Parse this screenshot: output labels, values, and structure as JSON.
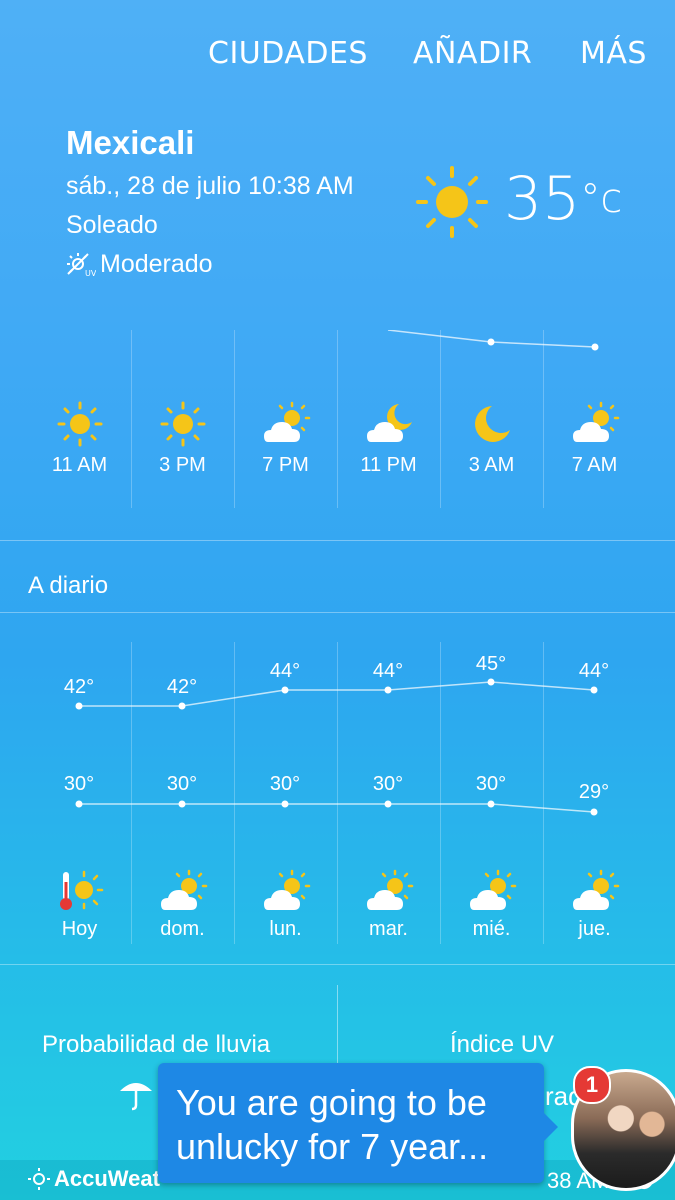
{
  "nav": {
    "items": [
      "CIUDADES",
      "AÑADIR",
      "MÁS"
    ]
  },
  "current": {
    "city": "Mexicali",
    "date": "sáb., 28 de julio 10:38 AM",
    "condition": "Soleado",
    "uv": "Moderado",
    "temperature": "35",
    "unit": "°c"
  },
  "hourly": [
    {
      "time": "11 AM",
      "icon": "sun-icon"
    },
    {
      "time": "3 PM",
      "icon": "sun-icon"
    },
    {
      "time": "7 PM",
      "icon": "partly-cloudy-day-icon"
    },
    {
      "time": "11 PM",
      "icon": "partly-cloudy-night-icon"
    },
    {
      "time": "3 AM",
      "icon": "moon-icon"
    },
    {
      "time": "7 AM",
      "icon": "partly-cloudy-day-icon"
    }
  ],
  "daily_header": "A diario",
  "daily": [
    {
      "day": "Hoy",
      "high": "42°",
      "low": "30°",
      "icon": "hot-sun-icon"
    },
    {
      "day": "dom.",
      "high": "42°",
      "low": "30°",
      "icon": "partly-cloudy-day-icon"
    },
    {
      "day": "lun.",
      "high": "44°",
      "low": "30°",
      "icon": "partly-cloudy-day-icon"
    },
    {
      "day": "mar.",
      "high": "44°",
      "low": "30°",
      "icon": "partly-cloudy-day-icon"
    },
    {
      "day": "mié.",
      "high": "45°",
      "low": "30°",
      "icon": "partly-cloudy-day-icon"
    },
    {
      "day": "jue.",
      "high": "44°",
      "low": "29°",
      "icon": "partly-cloudy-day-icon"
    }
  ],
  "daily_values": {
    "highs": [
      42,
      42,
      44,
      44,
      45,
      44
    ],
    "lows": [
      30,
      30,
      30,
      30,
      30,
      29
    ]
  },
  "panels": {
    "rain_title": "Probabilidad de lluvia",
    "uv_title": "Índice UV",
    "uv_value": "rad"
  },
  "footer": {
    "brand": "AccuWeat",
    "updated": "38 AM"
  },
  "notification": {
    "text": "You are going to be unlucky for 7 year...",
    "badge": "1"
  },
  "colors": {
    "sun": "#f5c518",
    "accent_blue": "#1e88e5",
    "badge_red": "#e53935"
  }
}
